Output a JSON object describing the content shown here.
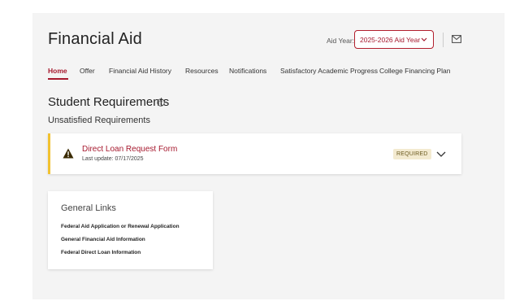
{
  "header": {
    "title": "Financial Aid",
    "aid_year_label": "Aid Year:",
    "aid_year_value": "2025-2026 Aid Year",
    "mail_icon": "mail-icon"
  },
  "nav": {
    "tabs": [
      {
        "label": "Home",
        "active": true
      },
      {
        "label": "Offer",
        "active": false
      },
      {
        "label": "Financial Aid History",
        "active": false
      },
      {
        "label": "Resources",
        "active": false
      },
      {
        "label": "Notifications",
        "active": false
      },
      {
        "label": "Satisfactory Academic Progress",
        "active": false
      },
      {
        "label": "College Financing Plan",
        "active": false
      }
    ]
  },
  "requirements": {
    "title": "Student Requirements",
    "help_icon": "help-circle-icon",
    "subtitle": "Unsatisfied Requirements",
    "items": [
      {
        "title": "Direct Loan Request Form",
        "updated": "Last update: 07/17/2025",
        "badge": "REQUIRED",
        "icon": "warning-icon"
      }
    ]
  },
  "general_links": {
    "title": "General Links",
    "links": [
      "Federal Aid Application or Renewal Application",
      "General Financial Aid Information",
      "Federal Direct Loan Information"
    ]
  },
  "colors": {
    "accent": "#a6192e",
    "warning": "#f2c230",
    "background": "#f4f4f4"
  }
}
